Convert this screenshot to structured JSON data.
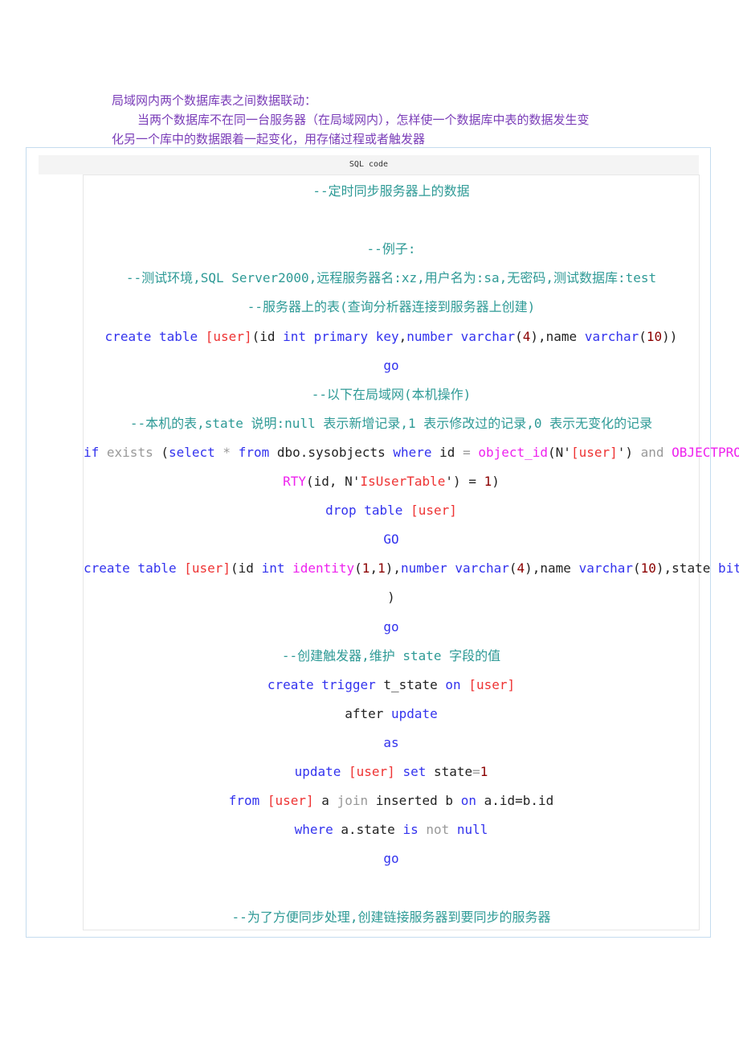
{
  "intro": {
    "title": "局域网内两个数据库表之间数据联动：",
    "para1": "当两个数据库不在同一台服务器（在局域网内），怎样使一个数据库中表的数据发生变",
    "para2": "化另一个库中的数据跟着一起变化，用存储过程或者触发器"
  },
  "code_block": {
    "header": "SQL code",
    "lines": [
      [
        {
          "t": "--定时同步服务器上的数据",
          "c": "c"
        }
      ],
      [],
      [
        {
          "t": "--例子:",
          "c": "c"
        }
      ],
      [
        {
          "t": "--测试环境,SQL Server2000,远程服务器名:xz,用户名为:sa,无密码,测试数据库:test",
          "c": "c"
        }
      ],
      [
        {
          "t": "--服务器上的表(查询分析器连接到服务器上创建)",
          "c": "c"
        }
      ],
      [
        {
          "t": "create table ",
          "c": "k"
        },
        {
          "t": "[user]",
          "c": "s"
        },
        {
          "t": "(id ",
          "c": "t"
        },
        {
          "t": "int primary key",
          "c": "k"
        },
        {
          "t": ",",
          "c": "t"
        },
        {
          "t": "number varchar",
          "c": "k"
        },
        {
          "t": "(",
          "c": "t"
        },
        {
          "t": "4",
          "c": "n"
        },
        {
          "t": "),name ",
          "c": "t"
        },
        {
          "t": "varchar",
          "c": "k"
        },
        {
          "t": "(",
          "c": "t"
        },
        {
          "t": "10",
          "c": "n"
        },
        {
          "t": "))",
          "c": "t"
        }
      ],
      [
        {
          "t": "go",
          "c": "k"
        }
      ],
      [
        {
          "t": "--以下在局域网(本机操作)",
          "c": "c"
        }
      ],
      [
        {
          "t": "--本机的表,state 说明:null 表示新增记录,1 表示修改过的记录,0 表示无变化的记录",
          "c": "c"
        }
      ],
      [
        {
          "t": "if ",
          "c": "k"
        },
        {
          "t": "exists ",
          "c": "g"
        },
        {
          "t": "(",
          "c": "t"
        },
        {
          "t": "select ",
          "c": "k"
        },
        {
          "t": "* ",
          "c": "g"
        },
        {
          "t": "from ",
          "c": "k"
        },
        {
          "t": "dbo.sysobjects ",
          "c": "t"
        },
        {
          "t": "where ",
          "c": "k"
        },
        {
          "t": "id ",
          "c": "t"
        },
        {
          "t": "= ",
          "c": "g"
        },
        {
          "t": "object_id",
          "c": "f"
        },
        {
          "t": "(N'",
          "c": "t"
        },
        {
          "t": "[user]",
          "c": "s"
        },
        {
          "t": "') ",
          "c": "t"
        },
        {
          "t": "and ",
          "c": "g"
        },
        {
          "t": "OBJECTPROPE",
          "c": "f"
        }
      ],
      [
        {
          "t": "RTY",
          "c": "f"
        },
        {
          "t": "(id, N'",
          "c": "t"
        },
        {
          "t": "IsUserTable",
          "c": "s"
        },
        {
          "t": "') = ",
          "c": "t"
        },
        {
          "t": "1",
          "c": "n"
        },
        {
          "t": ")",
          "c": "t"
        }
      ],
      [
        {
          "t": "drop table ",
          "c": "k"
        },
        {
          "t": "[user]",
          "c": "s"
        }
      ],
      [
        {
          "t": "GO",
          "c": "k"
        }
      ],
      [
        {
          "t": "create table ",
          "c": "k"
        },
        {
          "t": "[user]",
          "c": "s"
        },
        {
          "t": "(id ",
          "c": "t"
        },
        {
          "t": "int ",
          "c": "k"
        },
        {
          "t": "identity",
          "c": "f"
        },
        {
          "t": "(",
          "c": "t"
        },
        {
          "t": "1",
          "c": "n"
        },
        {
          "t": ",",
          "c": "t"
        },
        {
          "t": "1",
          "c": "n"
        },
        {
          "t": "),",
          "c": "t"
        },
        {
          "t": "number varchar",
          "c": "k"
        },
        {
          "t": "(",
          "c": "t"
        },
        {
          "t": "4",
          "c": "n"
        },
        {
          "t": "),name ",
          "c": "t"
        },
        {
          "t": "varchar",
          "c": "k"
        },
        {
          "t": "(",
          "c": "t"
        },
        {
          "t": "10",
          "c": "n"
        },
        {
          "t": "),state ",
          "c": "t"
        },
        {
          "t": "bit",
          "c": "k"
        }
      ],
      [
        {
          "t": ")",
          "c": "t"
        }
      ],
      [
        {
          "t": "go",
          "c": "k"
        }
      ],
      [
        {
          "t": "--创建触发器,维护 state 字段的值",
          "c": "c"
        }
      ],
      [
        {
          "t": "create trigger ",
          "c": "k"
        },
        {
          "t": "t_state ",
          "c": "t"
        },
        {
          "t": "on ",
          "c": "k"
        },
        {
          "t": "[user]",
          "c": "s"
        }
      ],
      [
        {
          "t": "after ",
          "c": "t"
        },
        {
          "t": "update",
          "c": "k"
        }
      ],
      [
        {
          "t": "as",
          "c": "k"
        }
      ],
      [
        {
          "t": "update ",
          "c": "k"
        },
        {
          "t": "[user] ",
          "c": "s"
        },
        {
          "t": "set ",
          "c": "k"
        },
        {
          "t": "state",
          "c": "t"
        },
        {
          "t": "=",
          "c": "g"
        },
        {
          "t": "1",
          "c": "n"
        }
      ],
      [
        {
          "t": "from ",
          "c": "k"
        },
        {
          "t": "[user] ",
          "c": "s"
        },
        {
          "t": "a ",
          "c": "t"
        },
        {
          "t": "join ",
          "c": "g"
        },
        {
          "t": "inserted b ",
          "c": "t"
        },
        {
          "t": "on ",
          "c": "k"
        },
        {
          "t": "a.id=b.id",
          "c": "t"
        }
      ],
      [
        {
          "t": "where ",
          "c": "k"
        },
        {
          "t": "a.state ",
          "c": "t"
        },
        {
          "t": "is ",
          "c": "k"
        },
        {
          "t": "not ",
          "c": "g"
        },
        {
          "t": "null",
          "c": "k"
        }
      ],
      [
        {
          "t": "go",
          "c": "k"
        }
      ],
      [],
      [
        {
          "t": "--为了方便同步处理,创建链接服务器到要同步的服务器",
          "c": "c"
        }
      ]
    ]
  }
}
